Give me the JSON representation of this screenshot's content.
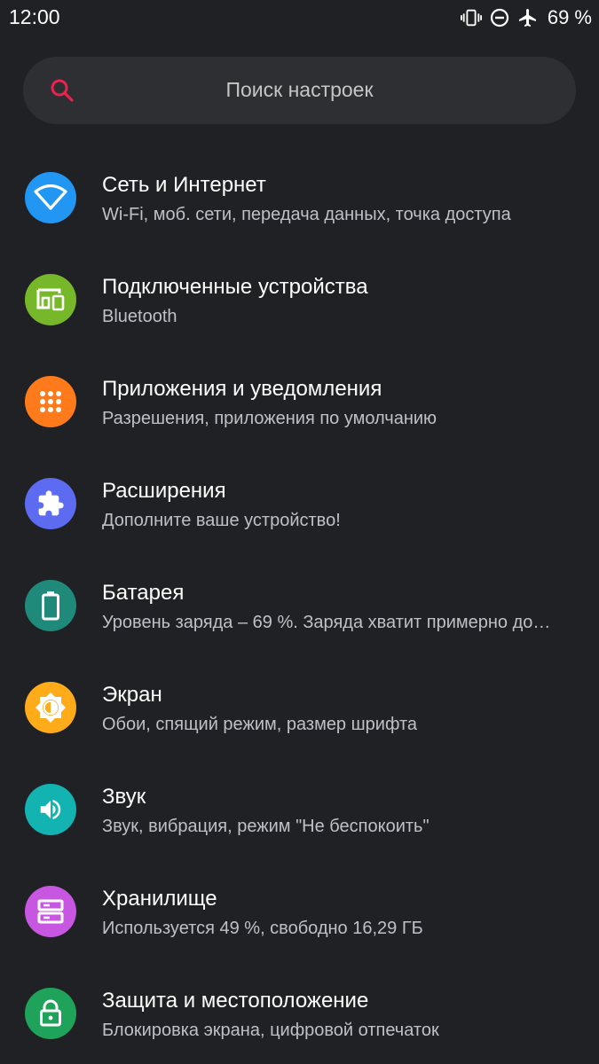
{
  "status_bar": {
    "time": "12:00",
    "battery": "69 %",
    "icons": [
      "vibrate-icon",
      "do-not-disturb-icon",
      "airplane-mode-icon"
    ]
  },
  "search": {
    "placeholder": "Поиск настроек",
    "icon": "search-icon",
    "accent_color": "#e8234e"
  },
  "settings": [
    {
      "title": "Сеть и Интернет",
      "subtitle": "Wi-Fi, моб. сети, передача данных, точка доступа",
      "icon": "wifi-icon",
      "color": "#2196f3"
    },
    {
      "title": "Подключенные устройства",
      "subtitle": "Bluetooth",
      "icon": "devices-icon",
      "color": "#76b82a"
    },
    {
      "title": "Приложения и уведомления",
      "subtitle": "Разрешения, приложения по умолчанию",
      "icon": "apps-grid-icon",
      "color": "#ff7a1a"
    },
    {
      "title": "Расширения",
      "subtitle": "Дополните ваше устройство!",
      "icon": "puzzle-icon",
      "color": "#5c6bf0"
    },
    {
      "title": "Батарея",
      "subtitle": "Уровень заряда – 69 %. Заряда хватит примерно до…",
      "icon": "battery-icon",
      "color": "#1f8a7a"
    },
    {
      "title": "Экран",
      "subtitle": "Обои, спящий режим, размер шрифта",
      "icon": "brightness-icon",
      "color": "#ffab1a"
    },
    {
      "title": "Звук",
      "subtitle": "Звук, вибрация, режим \"Не беспокоить\"",
      "icon": "volume-icon",
      "color": "#12b3b0"
    },
    {
      "title": "Хранилище",
      "subtitle": "Используется 49 %, свободно 16,29 ГБ",
      "icon": "storage-icon",
      "color": "#c757e0"
    },
    {
      "title": "Защита и местоположение",
      "subtitle": "Блокировка экрана, цифровой отпечаток",
      "icon": "lock-icon",
      "color": "#1fa35b"
    }
  ]
}
